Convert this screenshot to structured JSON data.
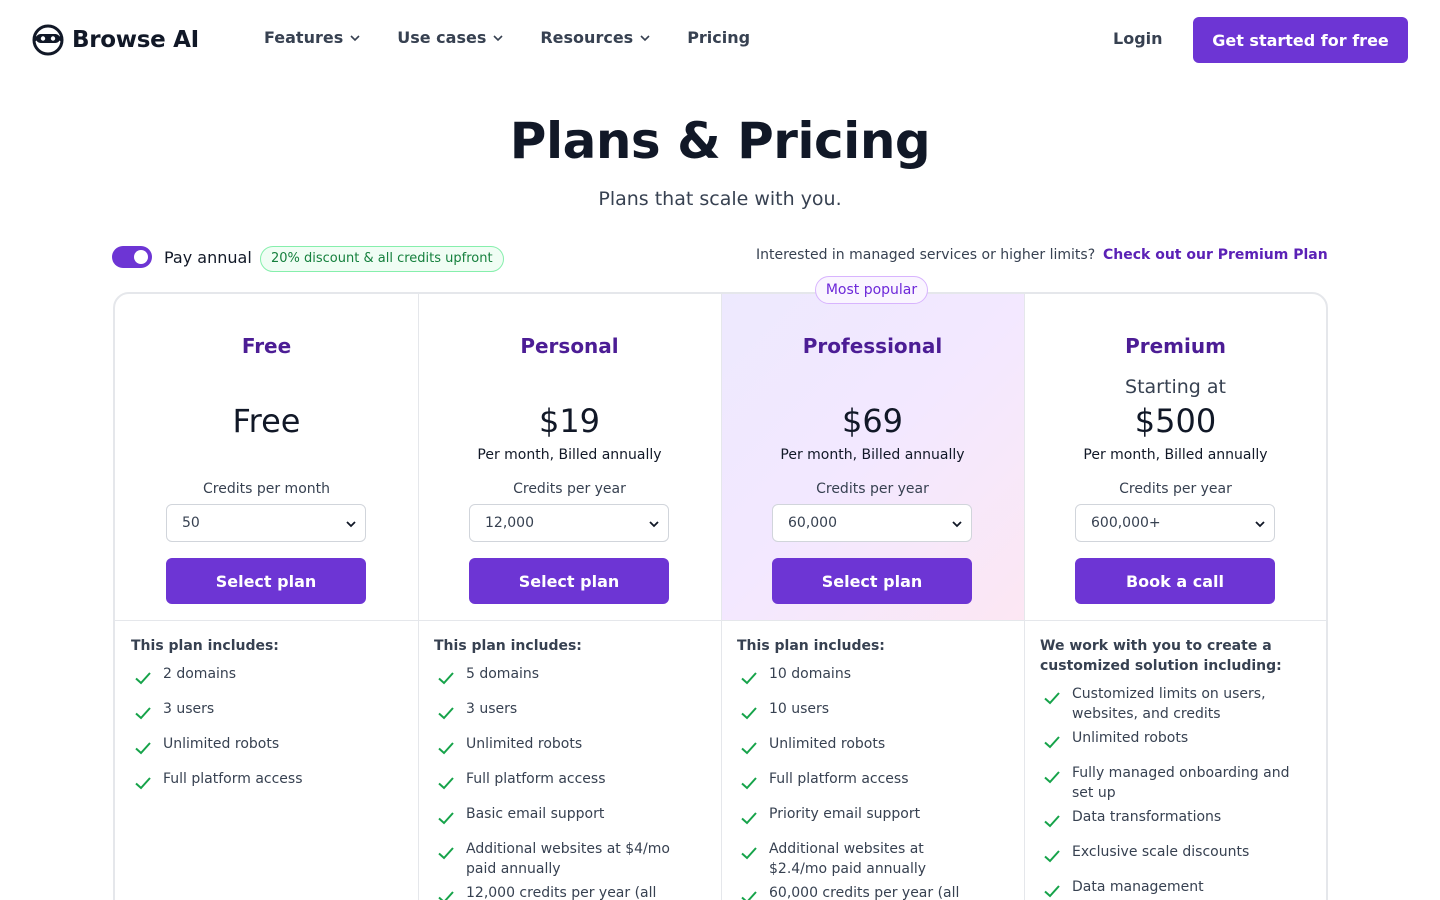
{
  "brand": {
    "name": "Browse AI"
  },
  "nav": {
    "features": "Features",
    "use_cases": "Use cases",
    "resources": "Resources",
    "pricing": "Pricing",
    "login": "Login",
    "cta": "Get started for free"
  },
  "hero": {
    "title": "Plans & Pricing",
    "subtitle": "Plans that scale with you."
  },
  "billing_toggle": {
    "label": "Pay annual",
    "enabled": true,
    "discount_badge": "20% discount & all credits upfront",
    "managed_text": "Interested in managed services or higher limits?",
    "premium_link": "Check out our Premium Plan"
  },
  "most_popular": "Most popular",
  "plans": [
    {
      "name": "Free",
      "starting": "",
      "price": "Free",
      "billing": "",
      "credits_label": "Credits per month",
      "credits_value": "50",
      "button": "Select plan",
      "includes_title": "This plan includes:",
      "features": [
        "2 domains",
        "3 users",
        "Unlimited robots",
        "Full platform access"
      ]
    },
    {
      "name": "Personal",
      "starting": "",
      "price": "$19",
      "billing": "Per month, Billed annually",
      "credits_label": "Credits per year",
      "credits_value": "12,000",
      "button": "Select plan",
      "includes_title": "This plan includes:",
      "features": [
        "5 domains",
        "3 users",
        "Unlimited robots",
        "Full platform access",
        "Basic email support",
        "Additional websites at $4/mo paid annually",
        "12,000 credits per year (all"
      ]
    },
    {
      "name": "Professional",
      "starting": "",
      "price": "$69",
      "billing": "Per month, Billed annually",
      "credits_label": "Credits per year",
      "credits_value": "60,000",
      "button": "Select plan",
      "includes_title": "This plan includes:",
      "features": [
        "10 domains",
        "10 users",
        "Unlimited robots",
        "Full platform access",
        "Priority email support",
        "Additional websites at $2.4/mo paid annually",
        "60,000 credits per year (all"
      ]
    },
    {
      "name": "Premium",
      "starting": "Starting at",
      "price": "$500",
      "billing": "Per month, Billed annually",
      "credits_label": "Credits per year",
      "credits_value": "600,000+",
      "button": "Book a call",
      "includes_title": "We work with you to create a customized solution including:",
      "features": [
        "Customized limits on users, websites, and credits",
        "Unlimited robots",
        "Fully managed onboarding and set up",
        "Data transformations",
        "Exclusive scale discounts",
        "Data management"
      ]
    }
  ],
  "colors": {
    "accent": "#6d35d4",
    "plan_name": "#4c1d95",
    "check": "#16a34a"
  }
}
